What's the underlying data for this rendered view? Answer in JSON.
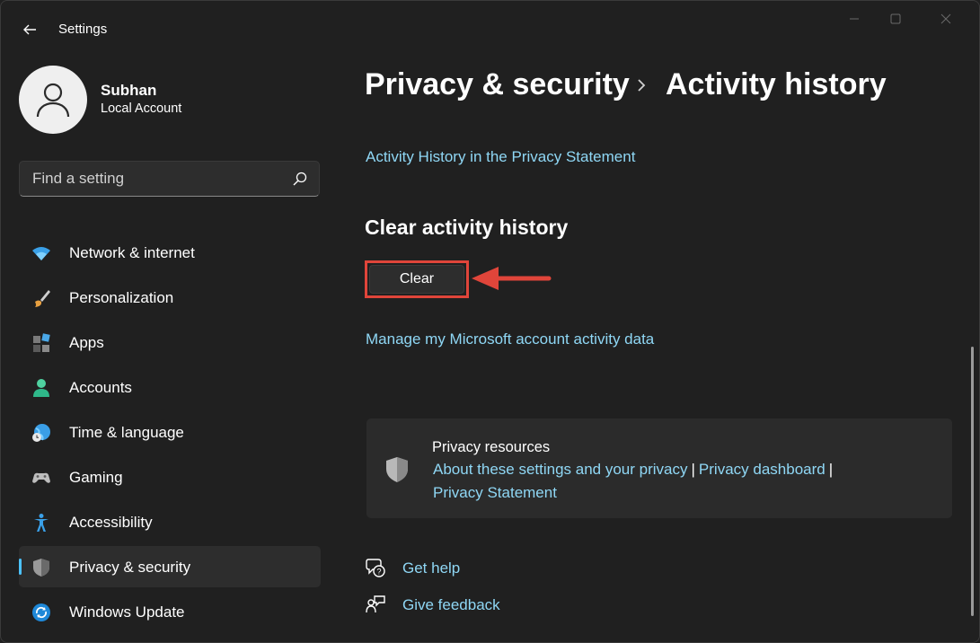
{
  "window": {
    "title": "Settings"
  },
  "user": {
    "name": "Subhan",
    "account_type": "Local Account"
  },
  "search": {
    "placeholder": "Find a setting"
  },
  "sidebar": {
    "items": [
      {
        "label": "Network & internet",
        "icon": "wifi-icon",
        "selected": false
      },
      {
        "label": "Personalization",
        "icon": "paintbrush-icon",
        "selected": false
      },
      {
        "label": "Apps",
        "icon": "apps-icon",
        "selected": false
      },
      {
        "label": "Accounts",
        "icon": "person-icon",
        "selected": false
      },
      {
        "label": "Time & language",
        "icon": "globe-clock-icon",
        "selected": false
      },
      {
        "label": "Gaming",
        "icon": "gamepad-icon",
        "selected": false
      },
      {
        "label": "Accessibility",
        "icon": "accessibility-icon",
        "selected": false
      },
      {
        "label": "Privacy & security",
        "icon": "shield-icon",
        "selected": true
      },
      {
        "label": "Windows Update",
        "icon": "update-icon",
        "selected": false
      }
    ]
  },
  "breadcrumb": {
    "parent": "Privacy & security",
    "current": "Activity history"
  },
  "main": {
    "privacy_statement_link": "Activity History in the Privacy Statement",
    "clear_section_title": "Clear activity history",
    "clear_button": "Clear",
    "manage_link": "Manage my Microsoft account activity data"
  },
  "resources": {
    "title": "Privacy resources",
    "links": [
      "About these settings and your privacy",
      "Privacy dashboard",
      "Privacy Statement"
    ],
    "separator": "|"
  },
  "help": {
    "get_help": "Get help",
    "give_feedback": "Give feedback"
  },
  "colors": {
    "accent": "#4cc2ff",
    "link": "#8fd7f5",
    "highlight": "#e0453a",
    "background": "#202020"
  }
}
